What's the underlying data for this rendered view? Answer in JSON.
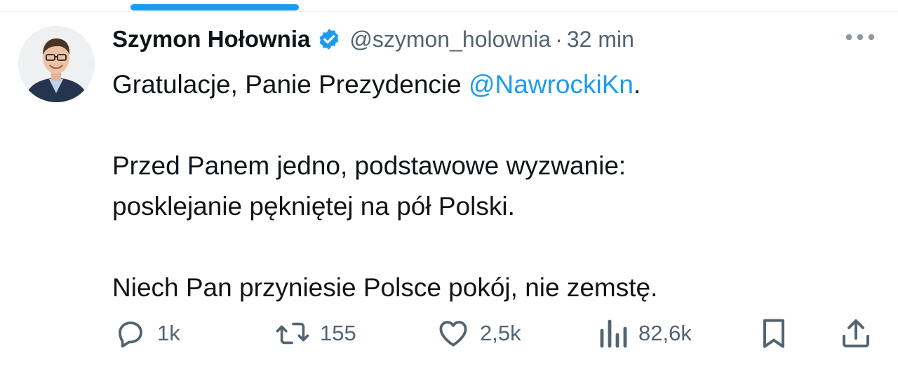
{
  "tweet": {
    "display_name": "Szymon Hołownia",
    "handle": "@szymon_holownia",
    "separator": "·",
    "time": "32 min",
    "text": {
      "line1_prefix": "Gratulacje, Panie Prezydencie ",
      "mention": "@NawrockiKn",
      "line1_suffix": ".",
      "paragraph2_line1": "Przed Panem jedno, podstawowe wyzwanie:",
      "paragraph2_line2": "posklejanie pękniętej na pół Polski.",
      "paragraph3": "Niech Pan przyniesie Polsce pokój, nie zemstę."
    }
  },
  "actions": {
    "reply_count": "1k",
    "retweet_count": "155",
    "like_count": "2,5k",
    "views_count": "82,6k"
  },
  "icons": {
    "verified": "verified-badge-icon",
    "more": "more-dots-icon",
    "reply": "reply-bubble-icon",
    "retweet": "retweet-icon",
    "like": "heart-icon",
    "views": "views-bar-icon",
    "bookmark": "bookmark-icon",
    "share": "share-icon"
  },
  "colors": {
    "accent": "#1d9bf0",
    "text": "#0f1419",
    "muted": "#536471"
  }
}
